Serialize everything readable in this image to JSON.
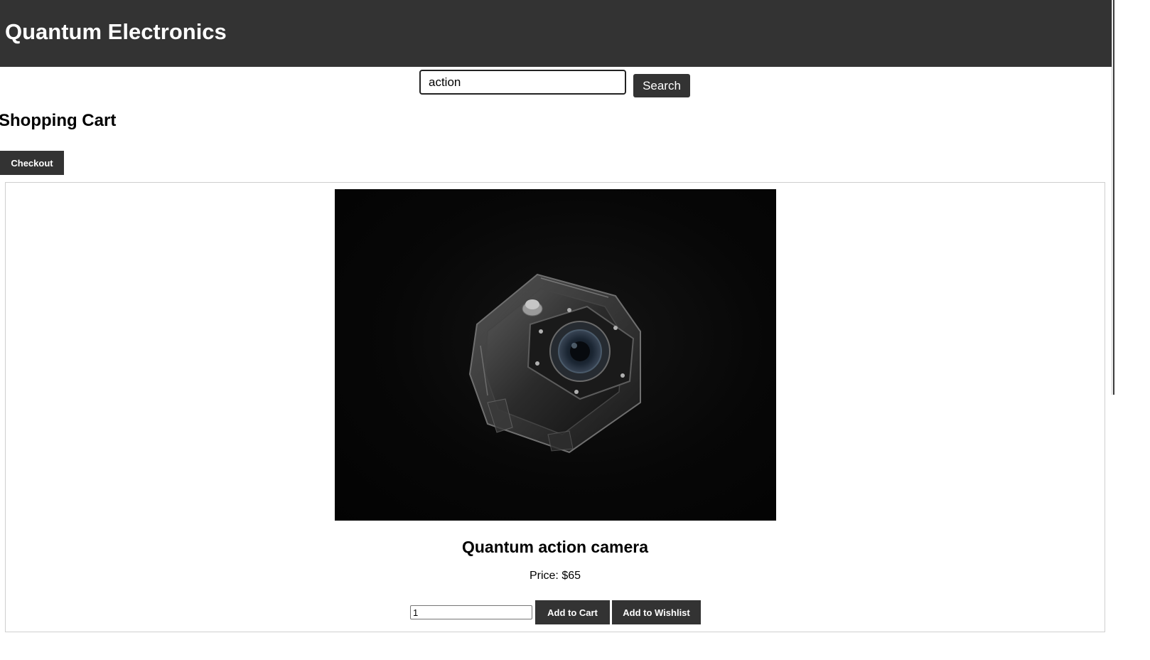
{
  "header": {
    "title": "Quantum Electronics"
  },
  "search": {
    "value": "action",
    "button_label": "Search"
  },
  "cart": {
    "heading": "Shopping Cart",
    "checkout_label": "Checkout"
  },
  "product": {
    "image_alt": "action camera in waterproof housing",
    "name": "Quantum action camera",
    "price_text": "Price: $65",
    "quantity_value": "1",
    "add_to_cart_label": "Add to Cart",
    "add_to_wishlist_label": "Add to Wishlist"
  },
  "colors": {
    "header_bg": "#333333",
    "button_bg": "#333333",
    "button_text": "#ffffff"
  }
}
